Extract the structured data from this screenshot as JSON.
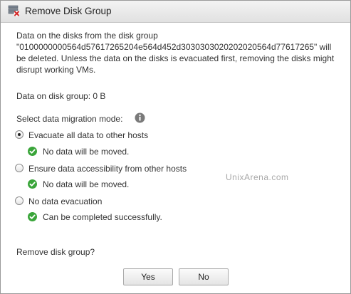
{
  "dialog": {
    "title": "Remove Disk Group",
    "icon": "disk-group-remove-icon"
  },
  "message": {
    "line1": "Data on the disks from the disk group",
    "line2": "\"0100000000564d57617265204e564d452d3030303020202020564d77617265\" will",
    "line3": "be deleted. Unless the data on the disks is evacuated first, removing the disks might",
    "line4": "disrupt working VMs."
  },
  "data_on_disk_group": "Data on disk group: 0 B",
  "migration": {
    "label": "Select data migration mode:",
    "info_icon": "info-icon",
    "selected": "Evacuate all data to other hosts",
    "options": [
      {
        "label": "Evacuate all data to other hosts",
        "checked": true,
        "status": "No data will be moved."
      },
      {
        "label": "Ensure data accessibility from other hosts",
        "checked": false,
        "status": "No data will be moved."
      },
      {
        "label": "No data evacuation",
        "checked": false,
        "status": "Can be completed successfully."
      }
    ],
    "status_icon": "green-check-icon",
    "status_color": "#3aa53a"
  },
  "watermark": "UnixArena.com",
  "question": "Remove disk group?",
  "buttons": {
    "yes": "Yes",
    "no": "No"
  }
}
